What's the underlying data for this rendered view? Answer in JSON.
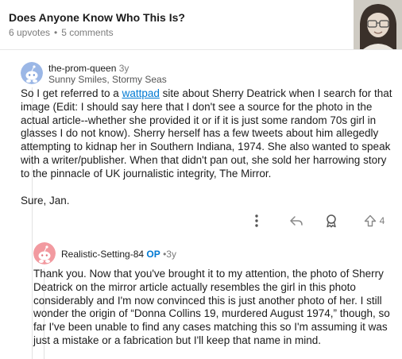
{
  "post": {
    "title": "Does Anyone Know Who This Is?",
    "upvotes": "6 upvotes",
    "separator": "•",
    "comments": "5 comments"
  },
  "comment1": {
    "author": "the-prom-queen",
    "time": "3y",
    "flair": "Sunny Smiles, Stormy Seas",
    "body_pre": "So I get referred to a ",
    "link": "wattpad",
    "body_post": " site about Sherry Deatrick when I search for that image (Edit: I should say here that I don't see a source for the photo in the actual article--whether she provided it or if it is just some random 70s girl in glasses I do not know).  Sherry herself has a few tweets about him allegedly attempting to kidnap her in Southern Indiana, 1974.  She also wanted to speak with a writer/publisher.  When that didn't pan out, she sold her harrowing story to the pinnacle of UK journalistic integrity, The Mirror.",
    "body_p2": "Sure, Jan.",
    "upvote_count": "4"
  },
  "comment2": {
    "author": "Realistic-Setting-84",
    "op_badge": "OP",
    "separator": "•",
    "time": "3y",
    "body": "Thank you. Now that you've brought it to my attention, the photo of Sherry Deatrick on the mirror article actually resembles the girl in this photo considerably and I'm now convinced this is just another photo of her. I still wonder the origin of “Donna Collins 19, murdered August 1974,” though, so far I've been unable to find any cases matching this so I'm assuming it was just a mistake or a fabrication but I'll keep that name in mind."
  },
  "icons": {
    "more": "more-vertical-icon",
    "reply": "reply-icon",
    "award": "award-icon",
    "upvote": "upvote-icon",
    "snoo": "snoo-avatar-icon"
  },
  "colors": {
    "avatar1": "#9bb7e6",
    "avatar2": "#f29aa0",
    "link": "#0079d3",
    "meta": "#7c7c7c"
  }
}
